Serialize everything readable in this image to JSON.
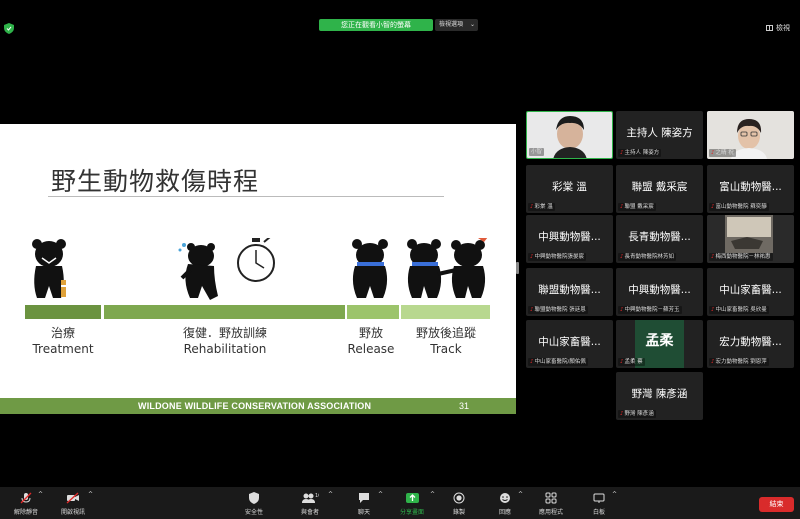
{
  "top_bar": {
    "viewing_banner": "您正在觀看小智的螢幕",
    "view_options_label": "檢視選項",
    "view_button_label": "檢視"
  },
  "slide": {
    "title": "野生動物救傷時程",
    "phases": [
      {
        "zh": "治療",
        "en": "Treatment"
      },
      {
        "zh": "復健．野放訓練",
        "en": "Rehabilitation"
      },
      {
        "zh": "野放",
        "en": "Release"
      },
      {
        "zh": "野放後追蹤",
        "en": "Track"
      }
    ],
    "footer_org": "WILDONE WILDLIFE CONSERVATION ASSOCIATION",
    "page_number": "31"
  },
  "gallery": [
    {
      "name": "",
      "label": "小智",
      "muted": false,
      "video": "person"
    },
    {
      "name": "主持人 陳姿方",
      "label": "主持人 陳姿方",
      "muted": true,
      "video": ""
    },
    {
      "name": "",
      "label": "之晴 祝",
      "muted": true,
      "video": "person"
    },
    {
      "name": "彩棠 溫",
      "label": "彩棠 溫",
      "muted": true,
      "video": ""
    },
    {
      "name": "聯盟 戴采宸",
      "label": "聯盟 戴采宸",
      "muted": true,
      "video": ""
    },
    {
      "name": "富山動物醫...",
      "label": "富山動物醫院 蘇奕靜",
      "muted": true,
      "video": ""
    },
    {
      "name": "中興動物醫...",
      "label": "中興動物醫院張晏宸",
      "muted": true,
      "video": ""
    },
    {
      "name": "長青動物醫...",
      "label": "長青動物醫院林芳如",
      "muted": true,
      "video": ""
    },
    {
      "name": "",
      "label": "梅西動物醫院－林祐惠",
      "muted": true,
      "video": "room"
    },
    {
      "name": "聯盟動物醫...",
      "label": "聯盟動物醫院 張廷恩",
      "muted": true,
      "video": ""
    },
    {
      "name": "中興動物醫...",
      "label": "中興動物醫院－蘇芳玉",
      "muted": true,
      "video": ""
    },
    {
      "name": "中山家畜醫...",
      "label": "中山家畜醫院 吳欣曼",
      "muted": true,
      "video": ""
    },
    {
      "name": "中山家畜醫...",
      "label": "中山家畜醫院/顏佑佩",
      "muted": true,
      "video": ""
    },
    {
      "name": "",
      "label": "孟柔 蔡",
      "muted": true,
      "video": "logo",
      "logo_text": "孟柔"
    },
    {
      "name": "宏力動物醫...",
      "label": "宏力動物醫院 劉恩萍",
      "muted": true,
      "video": ""
    },
    {
      "name": "野灣 陳彥涵",
      "label": "野灣 陳彥涵",
      "muted": true,
      "video": ""
    }
  ],
  "toolbar": {
    "unmute": "解除靜音",
    "start_video": "開啟視訊",
    "security": "安全性",
    "participants": "與會者",
    "participants_count": "16",
    "chat": "聊天",
    "share_screen": "分享畫面",
    "record": "錄製",
    "reactions": "回應",
    "apps": "應用程式",
    "whiteboard": "白板",
    "end": "結束"
  },
  "colors": {
    "accent_green": "#2fb34a",
    "slide_bar_green": "#7ea84f",
    "end_red": "#d92b2b",
    "muted_mic_red": "#e02828"
  }
}
